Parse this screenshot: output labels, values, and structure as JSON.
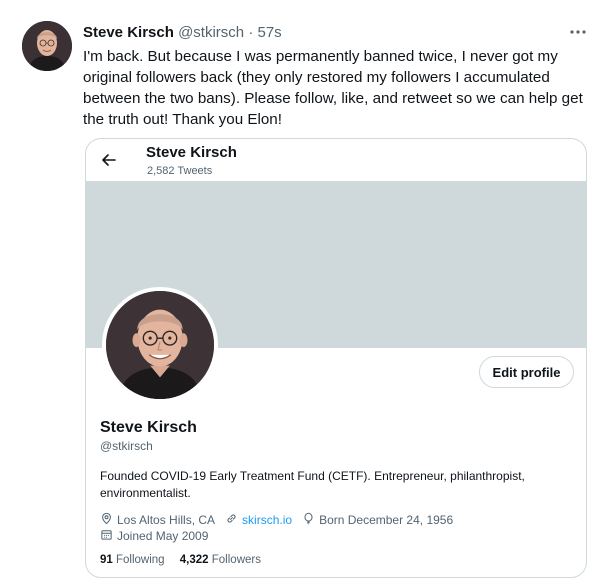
{
  "tweet": {
    "display_name": "Steve Kirsch",
    "handle": "@stkirsch",
    "separator": "·",
    "time": "57s",
    "text": "I'm back. But because I was permanently banned twice, I never got my original followers back (they only restored my followers I accumulated between the two bans). Please follow, like, and retweet so we can help get the truth out! Thank you Elon!"
  },
  "card": {
    "name": "Steve Kirsch",
    "tweets_count": "2,582 Tweets",
    "edit_profile_label": "Edit profile",
    "profile_name": "Steve Kirsch",
    "profile_handle": "@stkirsch",
    "bio": "Founded COVID-19 Early Treatment Fund (CETF). Entrepreneur, philanthropist, environmentalist.",
    "location": "Los Altos Hills, CA",
    "website": "skirsch.io",
    "born": "Born December 24, 1956",
    "joined": "Joined May 2009",
    "following_count": "91",
    "following_label": "Following",
    "followers_count": "4,322",
    "followers_label": "Followers"
  },
  "icons": {
    "more": "more-horizontal-icon",
    "back": "arrow-left-icon",
    "location": "location-pin-icon",
    "link": "link-icon",
    "birthday": "balloon-icon",
    "calendar": "calendar-icon"
  },
  "colors": {
    "text_primary": "#0f1419",
    "text_secondary": "#536471",
    "link": "#1d9bf0",
    "border": "#cfd9de",
    "banner": "#cfd9dc"
  }
}
